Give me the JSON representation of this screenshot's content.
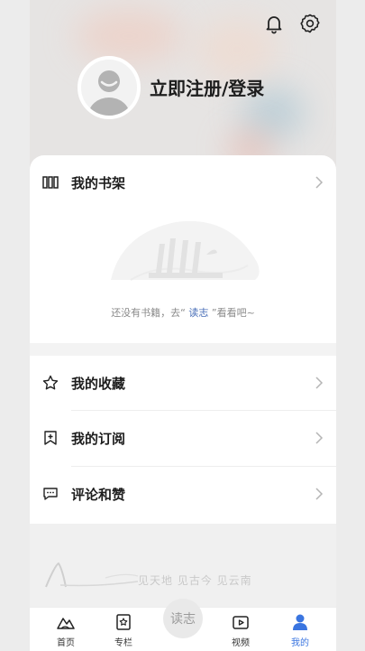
{
  "header": {
    "login_label": "立即注册/登录",
    "icons": [
      "bell-icon",
      "gear-icon"
    ]
  },
  "shelf": {
    "title": "我的书架",
    "empty_prefix": "还没有书籍，去“ ",
    "empty_link": "读志",
    "empty_suffix": " ”看看吧~"
  },
  "menu": [
    {
      "label": "我的收藏",
      "icon": "star-icon"
    },
    {
      "label": "我的订阅",
      "icon": "bookmark-plus-icon"
    },
    {
      "label": "评论和赞",
      "icon": "comment-icon"
    }
  ],
  "footer": {
    "slogan": "见天地  见古今  见云南"
  },
  "tabbar": {
    "items": [
      {
        "label": "首页",
        "icon": "mountain-icon"
      },
      {
        "label": "专栏",
        "icon": "column-icon"
      },
      {
        "label": "读志",
        "icon": "center-logo"
      },
      {
        "label": "视频",
        "icon": "video-icon"
      },
      {
        "label": "我的",
        "icon": "user-icon"
      }
    ],
    "active": "我的"
  },
  "colors": {
    "accent": "#3a75e0",
    "link": "#4a6fb8"
  }
}
